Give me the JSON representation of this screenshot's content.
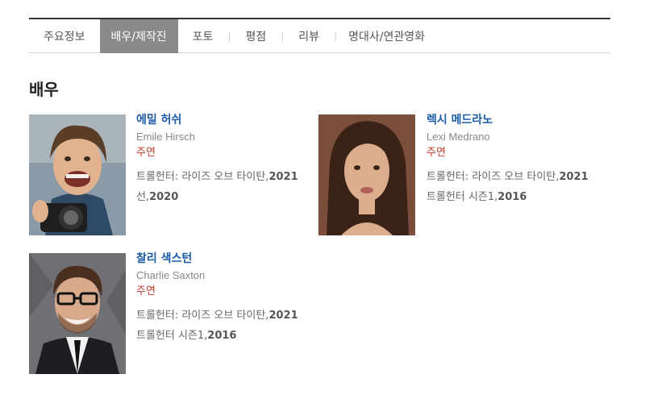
{
  "tabs": [
    {
      "label": "주요정보",
      "active": false
    },
    {
      "label": "배우/제작진",
      "active": true
    },
    {
      "label": "포토",
      "active": false
    },
    {
      "label": "평점",
      "active": false
    },
    {
      "label": "리뷰",
      "active": false
    },
    {
      "label": "명대사/연관영화",
      "active": false
    }
  ],
  "separator": "|",
  "section_title": "배우",
  "actors": [
    {
      "korean_name": "에밀 허쉬",
      "english_name": "Emile Hirsch",
      "role": "주연",
      "works": [
        {
          "title": "트롤헌터: 라이즈 오브 타이탄,",
          "year": "2021"
        },
        {
          "title": "선,",
          "year": "2020"
        }
      ]
    },
    {
      "korean_name": "렉시 메드라노",
      "english_name": "Lexi Medrano",
      "role": "주연",
      "works": [
        {
          "title": "트롤헌터: 라이즈 오브 타이탄,",
          "year": "2021"
        },
        {
          "title": "트롤헌터 시즌1,",
          "year": "2016"
        }
      ]
    },
    {
      "korean_name": "찰리 색스턴",
      "english_name": "Charlie Saxton",
      "role": "주연",
      "works": [
        {
          "title": "트롤헌터: 라이즈 오브 타이탄,",
          "year": "2021"
        },
        {
          "title": "트롤헌터 시즌1,",
          "year": "2016"
        }
      ]
    }
  ],
  "colors": {
    "active_tab_bg": "#8a8a8a",
    "name_link": "#1a5aa6",
    "role": "#c0392b"
  }
}
